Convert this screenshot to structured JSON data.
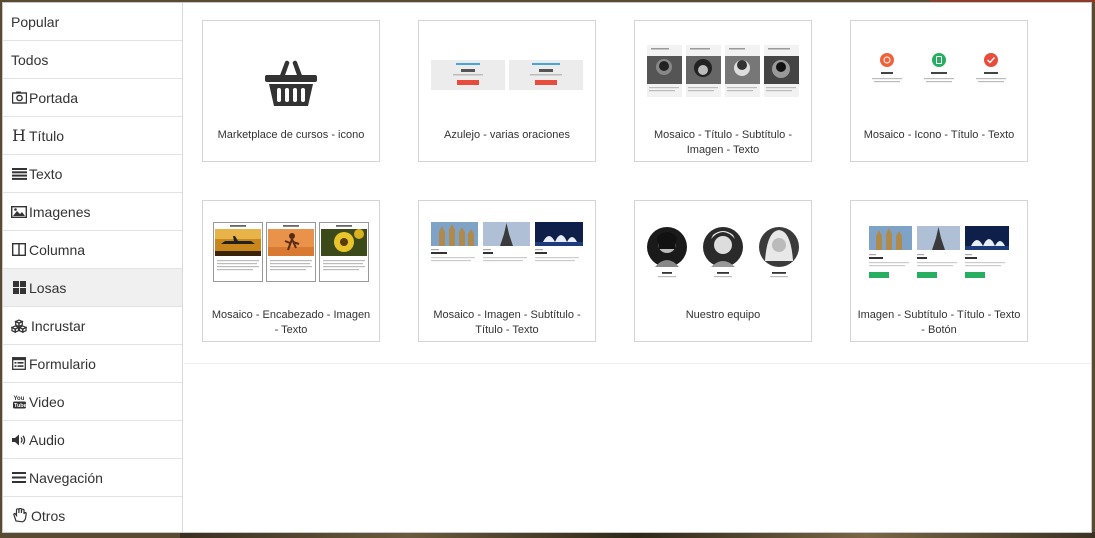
{
  "sidebar": {
    "items": [
      {
        "label": "Popular",
        "icon": "none"
      },
      {
        "label": "Todos",
        "icon": "none"
      },
      {
        "label": "Portada",
        "icon": "camera-icon"
      },
      {
        "label": "Título",
        "icon": "heading-icon"
      },
      {
        "label": "Texto",
        "icon": "text-lines-icon"
      },
      {
        "label": "Imagenes",
        "icon": "image-icon"
      },
      {
        "label": "Columna",
        "icon": "columns-icon"
      },
      {
        "label": "Losas",
        "icon": "tiles-icon"
      },
      {
        "label": "Incrustar",
        "icon": "cubes-icon"
      },
      {
        "label": "Formulario",
        "icon": "form-icon"
      },
      {
        "label": "Video",
        "icon": "youtube-icon"
      },
      {
        "label": "Audio",
        "icon": "speaker-icon"
      },
      {
        "label": "Navegación",
        "icon": "menu-icon"
      },
      {
        "label": "Otros",
        "icon": "hand-icon"
      }
    ],
    "active_index": 7
  },
  "cards": [
    {
      "label": "Marketplace de cursos - icono"
    },
    {
      "label": "Azulejo - varias oraciones"
    },
    {
      "label": "Mosaico - Título - Subtítulo - Imagen - Texto"
    },
    {
      "label": "Mosaico - Icono - Título - Texto"
    },
    {
      "label": "Mosaico - Encabezado - Imagen - Texto"
    },
    {
      "label": "Mosaico - Imagen - Subtítulo - Título - Texto"
    },
    {
      "label": "Nuestro equipo"
    },
    {
      "label": "Imagen - Subtítulo - Título - Texto - Botón"
    }
  ],
  "colors": {
    "accent_red": "#e74c3c",
    "accent_orange": "#f0623a",
    "accent_green": "#27ae60",
    "accent_blue": "#4aa3df"
  }
}
